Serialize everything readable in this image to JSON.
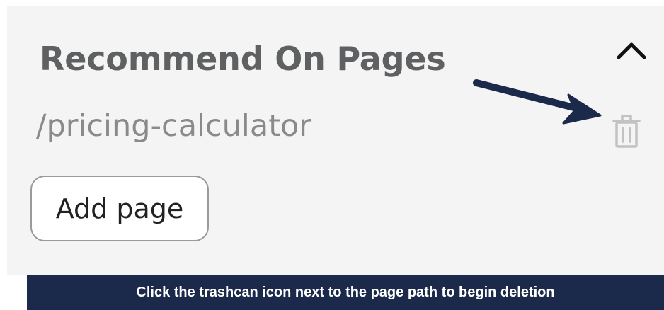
{
  "section": {
    "title": "Recommend On Pages",
    "collapse_icon": "chevron-up-icon"
  },
  "pages": [
    {
      "path": "/pricing-calculator",
      "delete_icon": "trash-icon"
    }
  ],
  "add_page": {
    "label": "Add page"
  },
  "annotation": {
    "arrow_color": "#1b2a4a",
    "caption": "Click the trashcan icon next to the page path to begin deletion"
  },
  "colors": {
    "panel_background": "#f4f4f4",
    "title_text": "#5f6062",
    "path_text": "#8a8a8a",
    "trash_icon": "#c2c2c2",
    "caption_bar": "#1b2a4a",
    "caption_text": "#ffffff"
  }
}
